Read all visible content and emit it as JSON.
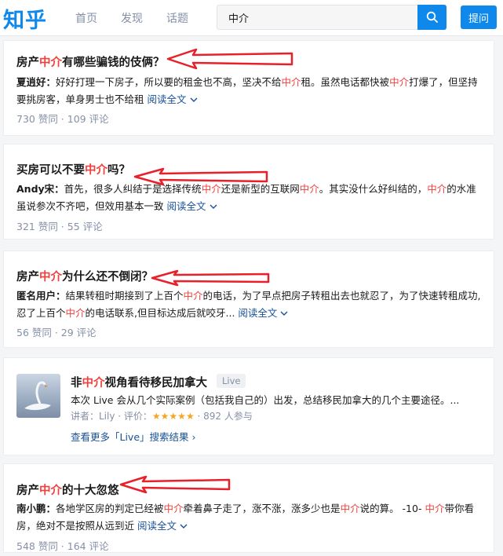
{
  "header": {
    "logo": "知乎",
    "nav": [
      "首页",
      "发现",
      "话题"
    ],
    "search_value": "中介",
    "ask_label": "提问"
  },
  "results": [
    {
      "title_a": "房产",
      "title_hl": "中介",
      "title_b": "有哪些骗钱的伎俩？",
      "author": "夏逍好：",
      "excerpt_1": "好好打理一下房子，所以要的租金也不高，坚决不给",
      "excerpt_hl_1": "中介",
      "excerpt_2": "租。虽然电话都快被",
      "excerpt_hl_2": "中介",
      "excerpt_3": "打爆了，但坚持要挑房客，单身男士也不给租",
      "read_more": "阅读全文",
      "meta": "730 赞同 · 109 评论"
    },
    {
      "title_a": "买房可以不要",
      "title_hl": "中介",
      "title_b": "吗？",
      "author": "Andy宋：",
      "excerpt_1": "首先，很多人纠结于是选择传统",
      "excerpt_hl_1": "中介",
      "excerpt_2": "还是新型的互联网",
      "excerpt_hl_2": "中介",
      "excerpt_3": "。其实没什么好纠结的，",
      "excerpt_hl_3": "中介",
      "excerpt_4": "的水准虽说参次不齐吧，但效用基本一致",
      "read_more": "阅读全文",
      "meta": "321 赞同 · 55 评论"
    },
    {
      "title_a": "房产",
      "title_hl": "中介",
      "title_b": "为什么还不倒闭？",
      "author": "匿名用户：",
      "excerpt_1": "结果转租时期接到了上百个",
      "excerpt_hl_1": "中介",
      "excerpt_2": "的电话，为了早点把房子转租出去也就忍了，为了快速转租成功,忍了上百个",
      "excerpt_hl_2": "中介",
      "excerpt_3": "的电话联系,但目标达成后就咬牙...",
      "read_more": "阅读全文",
      "meta": "56 赞同 · 29 评论"
    }
  ],
  "live": {
    "title_a": "非",
    "title_hl": "中介",
    "title_b": "视角看待移民加拿大",
    "badge": "Live",
    "desc": "本次 Live 会从几个实际案例（包括我自己的）出发，总结移民加拿大的几个主要途径。...",
    "speaker": "讲者：Lily · 评价：",
    "stars": "★★★★★",
    "participants": "· 892 人参与",
    "see_more": "查看更多「Live」搜索结果 ›"
  },
  "last": {
    "title_a": "房产",
    "title_hl": "中介",
    "title_b": "的十大忽悠",
    "author": "南小鹏：",
    "excerpt_1": "各地学区房的判定已经被",
    "excerpt_hl_1": "中介",
    "excerpt_2": "牵着鼻子走了，涨不涨，涨多少也是",
    "excerpt_hl_2": "中介",
    "excerpt_3": "说的算。 -10- ",
    "excerpt_hl_3": "中介",
    "excerpt_4": "带你看房，绝对不是按照从远到近",
    "read_more": "阅读全文",
    "meta": "548 赞同 · 164 评论"
  },
  "colors": {
    "brand": "#0f88eb",
    "highlight": "#f1403c",
    "arrow": "#e8202a",
    "link": "#175199",
    "meta": "#8590a6"
  },
  "icons": [
    "search-icon",
    "chevron-down-icon",
    "swan-thumbnail",
    "red-arrow-annotation"
  ]
}
